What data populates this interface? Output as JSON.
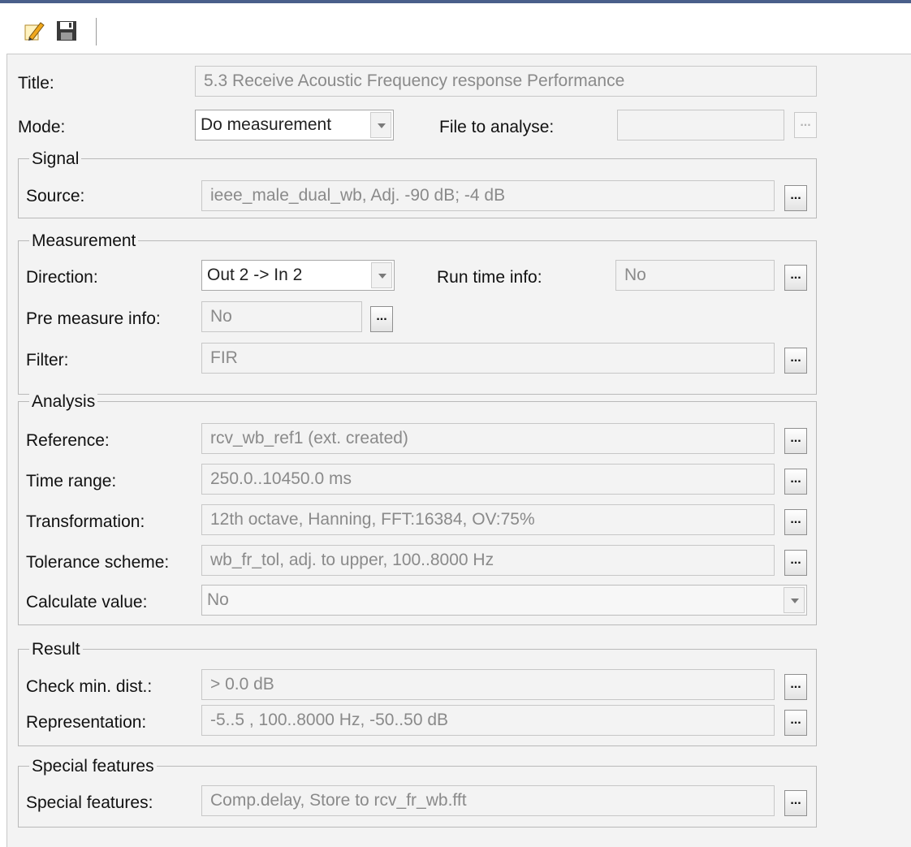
{
  "toolbar": {
    "edit_icon": "pencil-note-icon",
    "save_icon": "floppy-disk-icon"
  },
  "header": {
    "title_label": "Title:",
    "title_value": "5.3 Receive Acoustic Frequency response Performance",
    "mode_label": "Mode:",
    "mode_value": "Do measurement",
    "file_label": "File to analyse:",
    "file_value": "",
    "browse": "..."
  },
  "signal": {
    "group_title": "Signal",
    "source_label": "Source:",
    "source_value": "ieee_male_dual_wb, Adj. -90 dB; -4 dB"
  },
  "measurement": {
    "group_title": "Measurement",
    "direction_label": "Direction:",
    "direction_value": "Out 2 -> In 2",
    "runtime_label": "Run time info:",
    "runtime_value": "No",
    "premeasure_label": "Pre measure info:",
    "premeasure_value": "No",
    "filter_label": "Filter:",
    "filter_value": "FIR"
  },
  "analysis": {
    "group_title": "Analysis",
    "reference_label": "Reference:",
    "reference_value": "rcv_wb_ref1 (ext. created)",
    "timerange_label": "Time range:",
    "timerange_value": "250.0..10450.0 ms",
    "transformation_label": "Transformation:",
    "transformation_value": "12th octave, Hanning, FFT:16384, OV:75%",
    "tolerance_label": "Tolerance scheme:",
    "tolerance_value": "wb_fr_tol, adj. to upper, 100..8000 Hz",
    "calculate_label": "Calculate value:",
    "calculate_value": "No"
  },
  "result": {
    "group_title": "Result",
    "checkmin_label": "Check min. dist.:",
    "checkmin_value": "> 0.0 dB",
    "representation_label": "Representation:",
    "representation_value": "-5..5 , 100..8000 Hz, -50..50 dB"
  },
  "special": {
    "group_title": "Special features",
    "special_label": "Special features:",
    "special_value": "Comp.delay, Store to rcv_fr_wb.fft"
  }
}
